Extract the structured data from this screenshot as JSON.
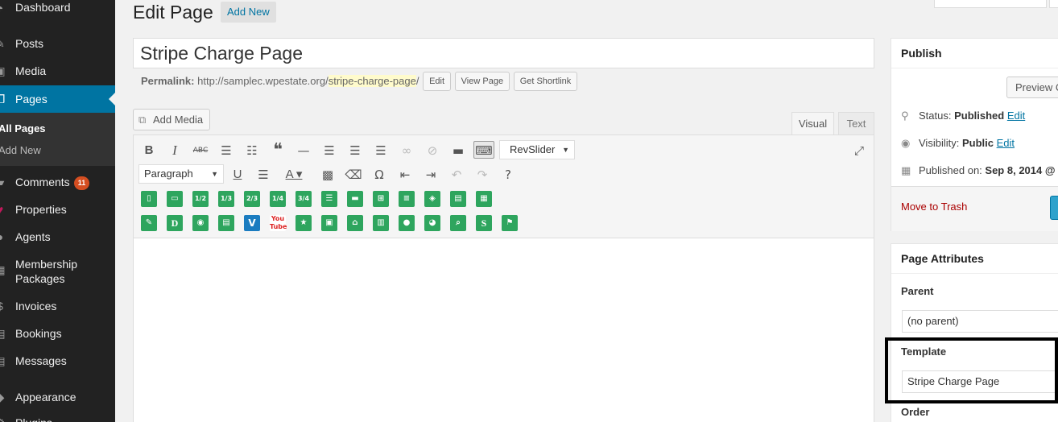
{
  "sidebar": {
    "items": [
      {
        "label": "Dashboard",
        "icon": "dashboard-icon"
      },
      {
        "label": "Posts",
        "icon": "pin-icon"
      },
      {
        "label": "Media",
        "icon": "media-icon"
      },
      {
        "label": "Pages",
        "icon": "pages-icon",
        "current": true
      },
      {
        "label": "Comments",
        "icon": "comments-icon",
        "badge": "11"
      },
      {
        "label": "Properties",
        "icon": "properties-icon"
      },
      {
        "label": "Agents",
        "icon": "agents-icon"
      },
      {
        "label": "Membership Packages",
        "label_line1": "Membership",
        "label_line2": "Packages",
        "icon": "membership-icon"
      },
      {
        "label": "Invoices",
        "icon": "invoices-icon"
      },
      {
        "label": "Bookings",
        "icon": "bookings-icon"
      },
      {
        "label": "Messages",
        "icon": "messages-icon"
      },
      {
        "label": "Appearance",
        "icon": "appearance-icon"
      },
      {
        "label": "Plugins",
        "icon": "plugins-icon"
      }
    ],
    "submenu": {
      "all_pages": "All Pages",
      "add_new": "Add New"
    }
  },
  "header": {
    "title": "Edit Page",
    "add_new": "Add New"
  },
  "post": {
    "title": "Stripe Charge Page",
    "permalink_label": "Permalink:",
    "permalink_base": "http://samplec.wpestate.org/",
    "permalink_slug": "stripe-charge-page",
    "permalink_end": "/",
    "edit_btn": "Edit",
    "view_btn": "View Page",
    "shortlink_btn": "Get Shortlink"
  },
  "editor": {
    "add_media": "Add Media",
    "tab_visual": "Visual",
    "tab_text": "Text",
    "revslider": "RevSlider",
    "format": "Paragraph",
    "shortcode_fractions": [
      "1/2",
      "1/3",
      "2/3",
      "1/4",
      "3/4"
    ]
  },
  "publish": {
    "title": "Publish",
    "preview": "Preview Changes",
    "status_label": "Status:",
    "status_value": "Published",
    "visibility_label": "Visibility:",
    "visibility_value": "Public",
    "published_on_label": "Published on:",
    "published_on_value": "Sep 8, 2014 @",
    "edit": "Edit",
    "trash": "Move to Trash"
  },
  "attributes": {
    "title": "Page Attributes",
    "parent_label": "Parent",
    "parent_value": "(no parent)",
    "template_label": "Template",
    "template_value": "Stripe Charge Page",
    "order_label": "Order"
  },
  "colors": {
    "sidebar_bg": "#222222",
    "current_bg": "#0074a2",
    "shortcode_green": "#2ea55e",
    "badge": "#d54e21",
    "link": "#0074a2",
    "trash": "#aa0000"
  }
}
